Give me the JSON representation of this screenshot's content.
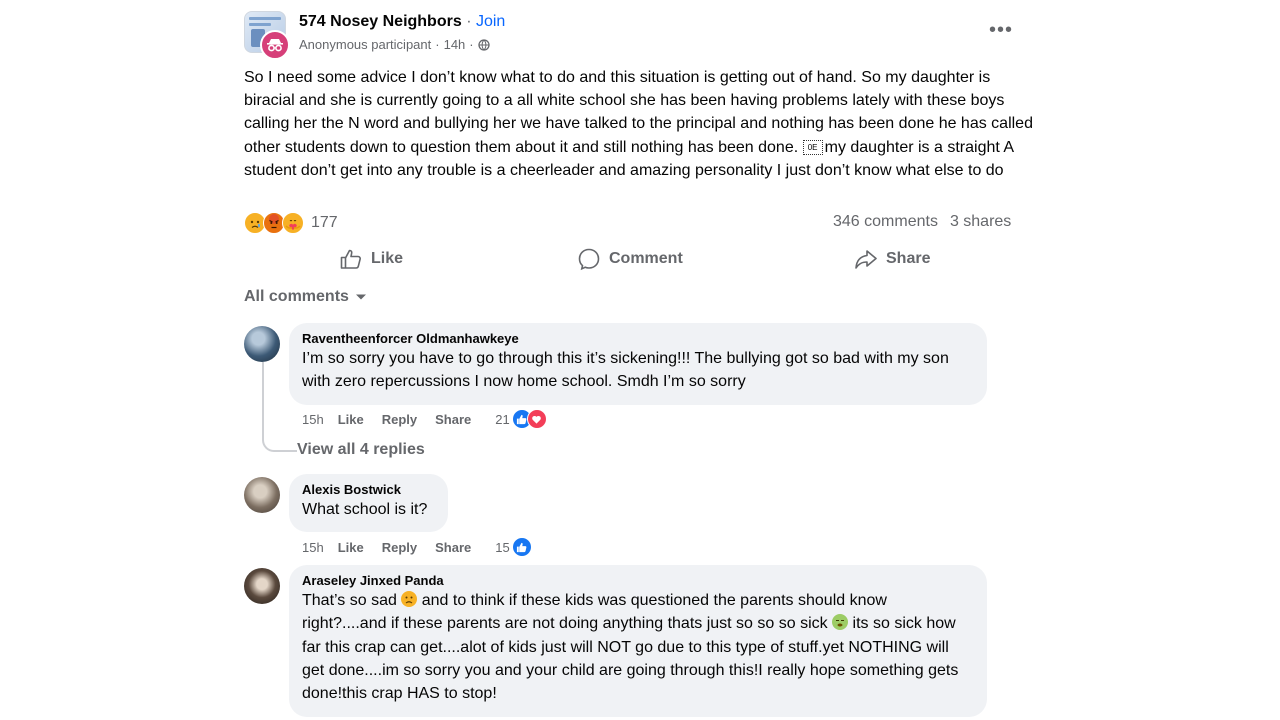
{
  "post": {
    "group_name": "574 Nosey Neighbors",
    "separator": "·",
    "join_label": "Join",
    "author": "Anonymous participant",
    "time": "14h",
    "visibility_icon": "globe-icon",
    "more_label": "•••",
    "text_part1": "So I need some advice I don’t know what to do and this situation is getting out of hand. So my daughter is biracial and she is currently going to a all white school she has been having problems lately with these boys calling her the N word and bullying her we have talked to the principal and nothing has been done he has called other students down to question them about it and still nothing has been done. ",
    "text_glyph": "0E",
    "text_part2": "my daughter is a straight A student don’t get into any trouble is a cheerleader and amazing personality I just don’t know what else to do",
    "reaction_icons": [
      "sad-reaction-icon",
      "angry-reaction-icon",
      "care-reaction-icon"
    ],
    "reaction_count": "177",
    "comments_count": "346 comments",
    "shares_count": "3 shares"
  },
  "actions": {
    "like": "Like",
    "comment": "Comment",
    "share": "Share"
  },
  "comments_header": "All comments",
  "comments": [
    {
      "name": "Raventheenforcer Oldmanhawkeye",
      "text": "I’m so sorry you have to go through this it’s sickening!!! The bullying got so bad with my son with zero repercussions I now home school. Smdh I’m so sorry",
      "time": "15h",
      "like": "Like",
      "reply": "Reply",
      "share": "Share",
      "reaction_count": "21",
      "reactions": [
        "like-reaction-icon",
        "love-reaction-icon"
      ],
      "view_replies": "View all 4 replies"
    },
    {
      "name": "Alexis Bostwick",
      "text": "What school is it?",
      "time": "15h",
      "like": "Like",
      "reply": "Reply",
      "share": "Share",
      "reaction_count": "15",
      "reactions": [
        "like-reaction-icon"
      ]
    },
    {
      "name": "Araseley Jinxed Panda",
      "text_a": "That’s so sad ",
      "text_b": " and to think if these kids was questioned the parents should know right?....and if these parents are not doing anything thats just so so so sick ",
      "text_c": " its so sick how far this crap can get....alot of kids just will NOT go due to this type of stuff.yet NOTHING will get done....im so sorry you and your child are going through this!I really hope something gets done!this crap HAS to stop!",
      "emojis": [
        "sad-face-emoji-icon",
        "sick-face-emoji-icon"
      ]
    }
  ],
  "colors": {
    "link_blue": "#0866ff",
    "secondary_text": "#65676b",
    "bubble_bg": "#f0f2f5",
    "anon_pink": "#d63f79",
    "like_blue": "#1877f2",
    "love_red": "#f33e58"
  }
}
